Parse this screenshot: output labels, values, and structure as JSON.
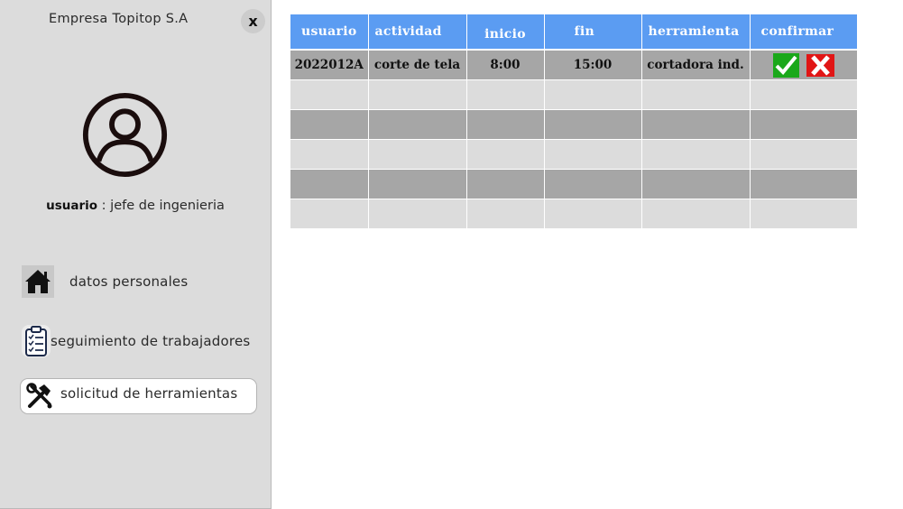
{
  "sidebar": {
    "company": "Empresa Topitop S.A",
    "close_label": "x",
    "user_label": "usuario",
    "user_role": " : jefe de ingenieria",
    "items": [
      {
        "label": "datos personales"
      },
      {
        "label": "seguimiento de trabajadores"
      },
      {
        "label": "solicitud de  herramientas"
      }
    ]
  },
  "table": {
    "headers": [
      "usuario",
      "actividad",
      "inicio",
      "fin",
      "herramienta",
      "confirmar"
    ],
    "rows": [
      [
        "2022012A",
        "corte de tela",
        "8:00",
        "15:00",
        "cortadora ind."
      ],
      [
        "",
        "",
        "",
        "",
        ""
      ],
      [
        "",
        "",
        "",
        "",
        ""
      ],
      [
        "",
        "",
        "",
        "",
        ""
      ],
      [
        "",
        "",
        "",
        "",
        ""
      ],
      [
        "",
        "",
        "",
        "",
        ""
      ]
    ]
  },
  "colors": {
    "header": "#5b9cf2",
    "row_dark": "#a6a6a6",
    "row_light": "#dcdcdc",
    "confirm": "#1aa81a",
    "reject": "#e11515"
  }
}
